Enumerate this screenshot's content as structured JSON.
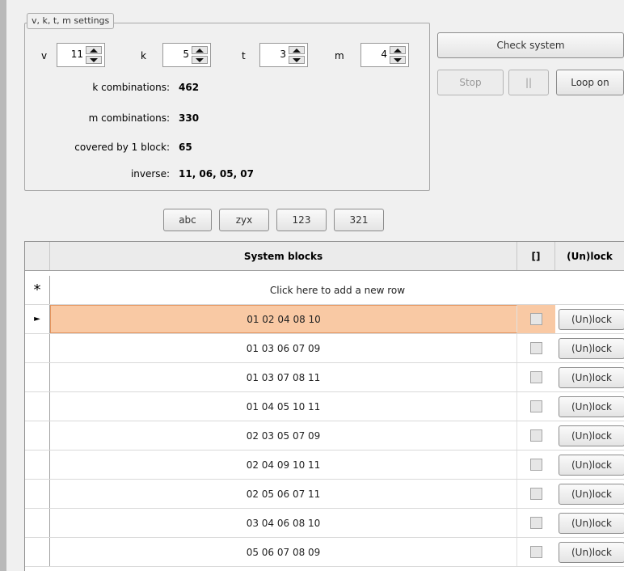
{
  "settings": {
    "title": "v, k, t, m settings",
    "v_label": "v",
    "v_value": "11",
    "k_label": "k",
    "k_value": "5",
    "t_label": "t",
    "t_value": "3",
    "m_label": "m",
    "m_value": "4",
    "k_combinations_label": "k combinations:",
    "k_combinations_value": "462",
    "m_combinations_label": "m combinations:",
    "m_combinations_value": "330",
    "covered_label": "covered by 1 block:",
    "covered_value": "65",
    "inverse_label": "inverse:",
    "inverse_value": "11, 06, 05, 07"
  },
  "actions": {
    "check_system": "Check system",
    "stop": "Stop",
    "pause": "||",
    "loop_on": "Loop on"
  },
  "sort_buttons": [
    "abc",
    "zyx",
    "123",
    "321"
  ],
  "grid": {
    "columns": [
      "",
      "System blocks",
      "[]",
      "(Un)lock"
    ],
    "new_row_marker": "*",
    "new_row_text": "Click here to add a new row",
    "current_row_marker": "►",
    "rows": [
      {
        "blocks": "01 02 04 08 10",
        "button": "(Un)lock"
      },
      {
        "blocks": "01 03 06 07 09",
        "button": "(Un)lock"
      },
      {
        "blocks": "01 03 07 08 11",
        "button": "(Un)lock"
      },
      {
        "blocks": "01 04 05 10 11",
        "button": "(Un)lock"
      },
      {
        "blocks": "02 03 05 07 09",
        "button": "(Un)lock"
      },
      {
        "blocks": "02 04 09 10 11",
        "button": "(Un)lock"
      },
      {
        "blocks": "02 05 06 07 11",
        "button": "(Un)lock"
      },
      {
        "blocks": "03 04 06 08 10",
        "button": "(Un)lock"
      },
      {
        "blocks": "05 06 07 08 09",
        "button": "(Un)lock"
      }
    ]
  },
  "colors": {
    "selected_row": "#f9c9a4",
    "selected_border": "#e4955f",
    "window_bg": "#f0f0f0"
  }
}
